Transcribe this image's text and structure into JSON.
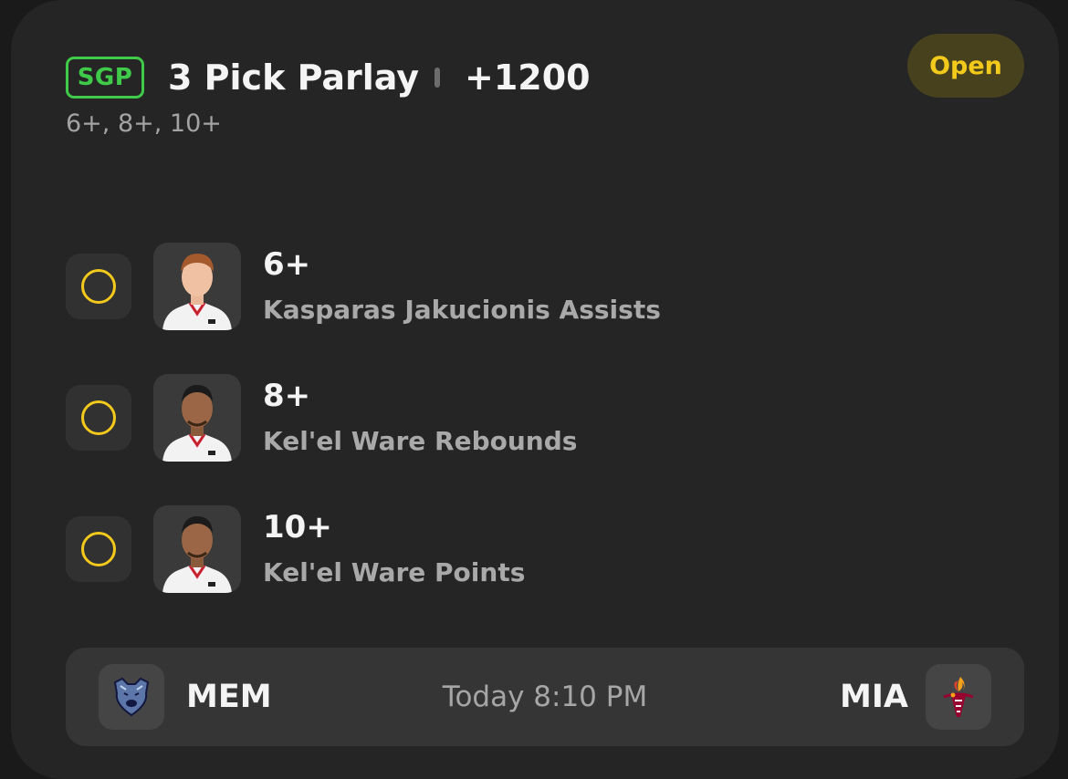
{
  "parlay": {
    "badge": "SGP",
    "title": "3 Pick Parlay",
    "odds": "+1200",
    "summary": "6+, 8+, 10+",
    "status": "Open"
  },
  "legs": [
    {
      "line": "6+",
      "market": "Kasparas Jakucionis Assists",
      "player_icon": "player-headshot"
    },
    {
      "line": "8+",
      "market": "Kel'el Ware Rebounds",
      "player_icon": "player-headshot"
    },
    {
      "line": "10+",
      "market": "Kel'el Ware Points",
      "player_icon": "player-headshot"
    }
  ],
  "game": {
    "away_team": "MEM",
    "home_team": "MIA",
    "time": "Today 8:10 PM"
  },
  "colors": {
    "accent_green": "#3fca4a",
    "accent_yellow": "#f3ca1c",
    "card_bg": "#252525"
  }
}
